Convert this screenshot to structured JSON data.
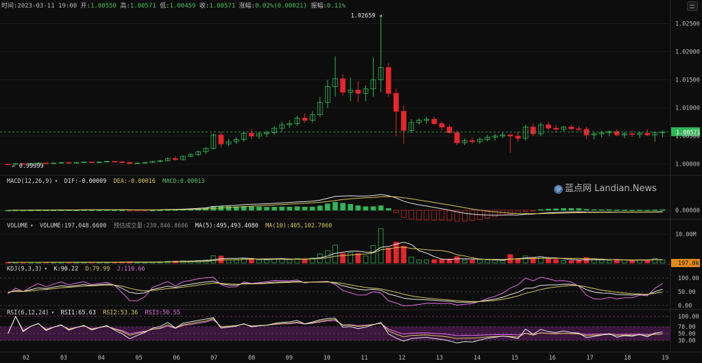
{
  "header": {
    "time_label": "时间:",
    "time": "2023-03-11 19:00",
    "open_label": "开:",
    "open": "1.00550",
    "high_label": "高:",
    "high": "1.00571",
    "low_label": "低:",
    "low": "1.00459",
    "close_label": "收:",
    "close": "1.00571",
    "change_label": "涨幅:",
    "change": "0.02%(0.00021)",
    "amplitude_label": "振幅:",
    "amplitude": "0.11%"
  },
  "watermark": {
    "icon": "@",
    "text": "蓝点网 Landian.News"
  },
  "colors": {
    "up": "#2fb655",
    "down": "#e5262b",
    "price_tag": "#2fb655",
    "volume_tag": "#e08a1a",
    "rsi_band": "#4a1a4e"
  },
  "chart_data": [
    {
      "type": "candlestick",
      "panel": "price",
      "yticks": [
        "1.02500",
        "1.02000",
        "1.01500",
        "1.01000",
        "1.00500",
        "1.00000"
      ],
      "ylim": [
        0.9985,
        1.0275
      ],
      "high_marker": "1.02659",
      "low_marker": "0.99999",
      "last_price": "1.00571",
      "ohlc_interval": "4h",
      "candles": [
        [
          1.0,
          1.0001,
          0.99985,
          0.99995
        ],
        [
          0.99995,
          1.0002,
          0.9999,
          1.0001
        ],
        [
          1.0001,
          1.0002,
          0.99995,
          1.0
        ],
        [
          1.0,
          1.0002,
          0.9999,
          1.0001
        ],
        [
          1.0001,
          1.0003,
          1.0,
          1.0002
        ],
        [
          1.0002,
          1.0003,
          1.0,
          1.0001
        ],
        [
          1.0001,
          1.0003,
          1.0,
          1.0002
        ],
        [
          1.0002,
          1.0004,
          1.0001,
          1.0003
        ],
        [
          1.0003,
          1.0004,
          1.0001,
          1.0002
        ],
        [
          1.0002,
          1.0004,
          1.0001,
          1.0003
        ],
        [
          1.0003,
          1.0005,
          1.0002,
          1.0004
        ],
        [
          1.0004,
          1.0005,
          1.0002,
          1.0003
        ],
        [
          1.0003,
          1.0005,
          1.0002,
          1.0004
        ],
        [
          1.0004,
          1.0006,
          1.0003,
          1.0005
        ],
        [
          1.0005,
          1.0006,
          1.0003,
          1.0004
        ],
        [
          1.0004,
          1.0006,
          1.0002,
          1.0003
        ],
        [
          1.0003,
          1.0005,
          0.99999,
          1.0001
        ],
        [
          1.0001,
          1.0003,
          0.99999,
          1.0002
        ],
        [
          1.0002,
          1.0004,
          1.0001,
          1.0003
        ],
        [
          1.0003,
          1.0006,
          1.0002,
          1.0005
        ],
        [
          1.0005,
          1.0008,
          1.0003,
          1.0006
        ],
        [
          1.0006,
          1.0012,
          1.0005,
          1.001
        ],
        [
          1.001,
          1.0014,
          1.0006,
          1.0008
        ],
        [
          1.0008,
          1.0016,
          1.0007,
          1.0014
        ],
        [
          1.0014,
          1.002,
          1.0012,
          1.0017
        ],
        [
          1.0017,
          1.0024,
          1.0014,
          1.0022
        ],
        [
          1.0022,
          1.003,
          1.0018,
          1.0028
        ],
        [
          1.0028,
          1.0055,
          1.0026,
          1.0052
        ],
        [
          1.0052,
          1.0058,
          1.003,
          1.0036
        ],
        [
          1.0036,
          1.0045,
          1.0032,
          1.004
        ],
        [
          1.004,
          1.0048,
          1.0036,
          1.0044
        ],
        [
          1.0044,
          1.0058,
          1.004,
          1.0055
        ],
        [
          1.0055,
          1.0062,
          1.0044,
          1.005
        ],
        [
          1.005,
          1.0058,
          1.0045,
          1.0054
        ],
        [
          1.0054,
          1.006,
          1.0048,
          1.0056
        ],
        [
          1.0056,
          1.0068,
          1.0052,
          1.0064
        ],
        [
          1.0064,
          1.0076,
          1.0058,
          1.007
        ],
        [
          1.007,
          1.0078,
          1.0064,
          1.0072
        ],
        [
          1.0072,
          1.0086,
          1.0068,
          1.0082
        ],
        [
          1.0082,
          1.009,
          1.0074,
          1.0078
        ],
        [
          1.0078,
          1.0094,
          1.0074,
          1.0088
        ],
        [
          1.0088,
          1.012,
          1.0084,
          1.011
        ],
        [
          1.011,
          1.015,
          1.01,
          1.0138
        ],
        [
          1.0138,
          1.0192,
          1.012,
          1.0152
        ],
        [
          1.0152,
          1.016,
          1.0122,
          1.0128
        ],
        [
          1.0128,
          1.0154,
          1.0112,
          1.0132
        ],
        [
          1.0132,
          1.0148,
          1.011,
          1.0126
        ],
        [
          1.0126,
          1.014,
          1.0112,
          1.0134
        ],
        [
          1.0134,
          1.019,
          1.012,
          1.015
        ],
        [
          1.015,
          1.02659,
          1.0128,
          1.0172
        ],
        [
          1.0172,
          1.018,
          1.012,
          1.0126
        ],
        [
          1.0126,
          1.0134,
          1.005,
          1.0094
        ],
        [
          1.0094,
          1.0104,
          1.0036,
          1.006
        ],
        [
          1.006,
          1.008,
          1.0056,
          1.0074
        ],
        [
          1.0074,
          1.0082,
          1.007,
          1.0078
        ],
        [
          1.0078,
          1.0084,
          1.0072,
          1.008
        ],
        [
          1.008,
          1.0084,
          1.007,
          1.0072
        ],
        [
          1.0072,
          1.0076,
          1.006,
          1.0066
        ],
        [
          1.0066,
          1.007,
          1.0054,
          1.0056
        ],
        [
          1.0056,
          1.006,
          1.0034,
          1.0038
        ],
        [
          1.0038,
          1.0046,
          1.0034,
          1.0042
        ],
        [
          1.0042,
          1.0048,
          1.0036,
          1.004
        ],
        [
          1.004,
          1.0048,
          1.0036,
          1.0044
        ],
        [
          1.0044,
          1.0052,
          1.004,
          1.0048
        ],
        [
          1.0048,
          1.0054,
          1.0042,
          1.005
        ],
        [
          1.005,
          1.0056,
          1.0046,
          1.0052
        ],
        [
          1.0052,
          1.0054,
          1.002,
          1.005
        ],
        [
          1.005,
          1.0058,
          1.004,
          1.0046
        ],
        [
          1.0046,
          1.007,
          1.0042,
          1.0066
        ],
        [
          1.0066,
          1.0072,
          1.005,
          1.0054
        ],
        [
          1.0054,
          1.0074,
          1.005,
          1.007
        ],
        [
          1.007,
          1.0076,
          1.006,
          1.0064
        ],
        [
          1.0064,
          1.007,
          1.0056,
          1.0062
        ],
        [
          1.0062,
          1.0068,
          1.0058,
          1.0066
        ],
        [
          1.0066,
          1.007,
          1.006,
          1.0063
        ],
        [
          1.0063,
          1.0068,
          1.0058,
          1.0062
        ],
        [
          1.0062,
          1.0066,
          1.0044,
          1.0052
        ],
        [
          1.0052,
          1.0058,
          1.0044,
          1.0054
        ],
        [
          1.0054,
          1.006,
          1.0048,
          1.0056
        ],
        [
          1.0056,
          1.006,
          1.005,
          1.0058
        ],
        [
          1.0058,
          1.0062,
          1.005,
          1.0052
        ],
        [
          1.0052,
          1.0058,
          1.0046,
          1.0054
        ],
        [
          1.0054,
          1.006,
          1.0048,
          1.0053
        ],
        [
          1.0053,
          1.0058,
          1.0046,
          1.0055
        ],
        [
          1.0055,
          1.0062,
          1.005,
          1.0052
        ],
        [
          1.0052,
          1.0058,
          1.004,
          1.0056
        ],
        [
          1.0056,
          1.006,
          1.0048,
          1.0057
        ]
      ]
    },
    {
      "type": "macd",
      "panel": "macd",
      "label": "MACD(12,26,9)",
      "dif_label": "DIF:",
      "dif": "-0.00009",
      "dea_label": "DEA:",
      "dea": "-0.00016",
      "macd_label": "MACD:",
      "macd": "0.00013",
      "ytick": "0.00000"
    },
    {
      "type": "volume",
      "panel": "volume",
      "label": "VOLUME",
      "volume_label": "VOLUME:",
      "volume": "197,048.6600",
      "est_label": "预估成交量:",
      "est": "238,846.8606",
      "ma5_label": "MA(5):",
      "ma5": "495,493.4080",
      "ma10_label": "MA(10):",
      "ma10": "405,102.7060",
      "ytick": "10.00M",
      "last_tag": "197.0k"
    },
    {
      "type": "kdj",
      "panel": "kdj",
      "label": "KDJ(9,3,3)",
      "k_label": "K:",
      "k": "90.22",
      "d_label": "D:",
      "d": "79.99",
      "j_label": "J:",
      "j": "110.66",
      "yticks": [
        "100.00",
        "50.00",
        "0.00"
      ]
    },
    {
      "type": "rsi",
      "panel": "rsi",
      "label": "RSI(6,12,24)",
      "rsi1_label": "RSI1:",
      "rsi1": "65.63",
      "rsi2_label": "RSI2:",
      "rsi2": "53.36",
      "rsi3_label": "RSI3:",
      "rsi3": "50.55",
      "yticks": [
        "100.00",
        "70.00",
        "50.00",
        "30.00"
      ]
    }
  ],
  "x_axis": {
    "ticks": [
      "02",
      "03",
      "04",
      "05",
      "06",
      "07",
      "08",
      "09",
      "10",
      "11",
      "12",
      "13",
      "14",
      "15",
      "16",
      "17",
      "18",
      "19"
    ]
  }
}
